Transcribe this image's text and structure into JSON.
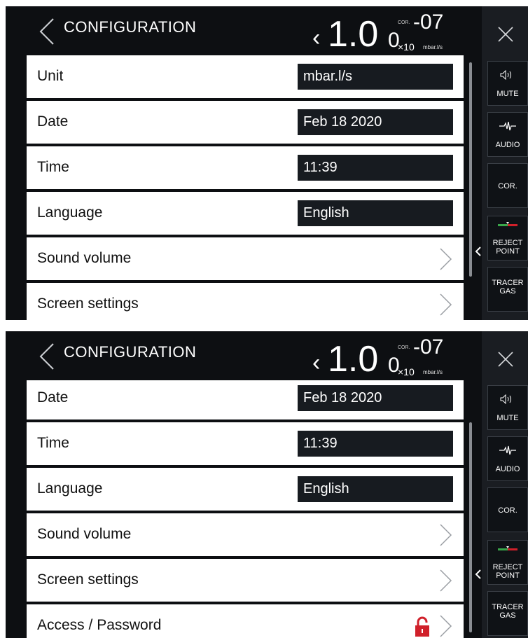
{
  "screens": [
    {
      "header": {
        "title": "CONFIGURATION",
        "reading": {
          "prefix": "‹",
          "mantissa": "1.0",
          "mantissa_small": "0",
          "cor_label": "COR.",
          "exponent": "-07",
          "multiplier": "×10",
          "unit": "mbar.l/s"
        }
      },
      "rows": [
        {
          "label": "Unit",
          "value": "mbar.l/s",
          "kind": "value"
        },
        {
          "label": "Date",
          "value": "Feb 18 2020",
          "kind": "value"
        },
        {
          "label": "Time",
          "value": "11:39",
          "kind": "value"
        },
        {
          "label": "Language",
          "value": "English",
          "kind": "value"
        },
        {
          "label": "Sound volume",
          "kind": "nav"
        },
        {
          "label": "Screen settings",
          "kind": "nav"
        }
      ],
      "sidebar": {
        "mute": "MUTE",
        "audio": "AUDIO",
        "cor": "COR.",
        "reject_line1": "REJECT",
        "reject_line2": "POINT",
        "tracer_line1": "TRACER",
        "tracer_line2": "GAS"
      }
    },
    {
      "header": {
        "title": "CONFIGURATION",
        "reading": {
          "prefix": "‹",
          "mantissa": "1.0",
          "mantissa_small": "0",
          "cor_label": "COR.",
          "exponent": "-07",
          "multiplier": "×10",
          "unit": "mbar.l/s"
        }
      },
      "rows": [
        {
          "label": "Date",
          "value": "Feb 18 2020",
          "kind": "value"
        },
        {
          "label": "Time",
          "value": "11:39",
          "kind": "value"
        },
        {
          "label": "Language",
          "value": "English",
          "kind": "value"
        },
        {
          "label": "Sound volume",
          "kind": "nav"
        },
        {
          "label": "Screen settings",
          "kind": "nav"
        },
        {
          "label": "Access / Password",
          "kind": "nav",
          "locked": true
        }
      ],
      "sidebar": {
        "mute": "MUTE",
        "audio": "AUDIO",
        "cor": "COR.",
        "reject_line1": "REJECT",
        "reject_line2": "POINT",
        "tracer_line1": "TRACER",
        "tracer_line2": "GAS"
      }
    }
  ],
  "colors": {
    "background": "#0d0f12",
    "sidebar": "#1a1d22",
    "value_box": "#171b20",
    "lock": "#d0202a",
    "reject_green": "#3aa64a",
    "reject_red": "#d0202a"
  }
}
